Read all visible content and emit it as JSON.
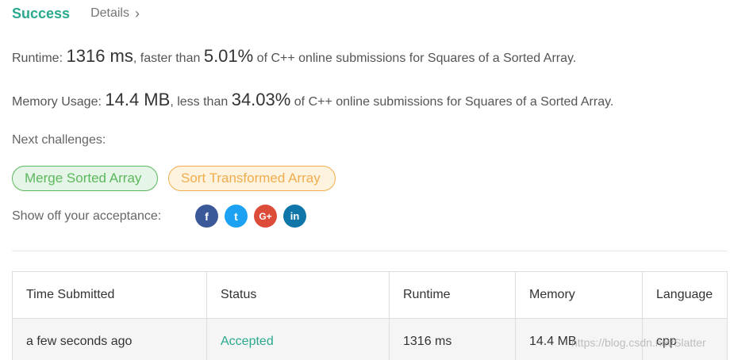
{
  "header": {
    "status": "Success",
    "details_label": "Details",
    "chevron": "›"
  },
  "runtime": {
    "label": "Runtime:",
    "value": "1316 ms",
    "mid_text": ", faster than",
    "percent": "5.01%",
    "tail_text": "of C++ online submissions for Squares of a Sorted Array."
  },
  "memory": {
    "label": "Memory Usage:",
    "value": "14.4 MB",
    "mid_text": ", less than",
    "percent": "34.03%",
    "tail_text": "of C++ online submissions for Squares of a Sorted Array."
  },
  "next": {
    "label": "Next challenges:",
    "challenges": [
      "Merge Sorted Array",
      "Sort Transformed Array"
    ]
  },
  "share": {
    "label": "Show off your acceptance:",
    "icons": [
      {
        "name": "facebook-icon",
        "glyph": "f"
      },
      {
        "name": "twitter-icon",
        "glyph": "t"
      },
      {
        "name": "google-plus-icon",
        "glyph": "G+"
      },
      {
        "name": "linkedin-icon",
        "glyph": "in"
      }
    ]
  },
  "table": {
    "headers": [
      "Time Submitted",
      "Status",
      "Runtime",
      "Memory",
      "Language"
    ],
    "rows": [
      [
        "a few seconds ago",
        "Accepted",
        "1316 ms",
        "14.4 MB",
        "cpp"
      ]
    ]
  },
  "watermark": "https://blog.csdn.net/Slatter",
  "colors": {
    "success": "#2aa98e",
    "green_chip": "#5cb85c",
    "orange_chip": "#f0ad4e",
    "facebook": "#3b5998",
    "twitter": "#1da1f2",
    "google_plus": "#dd4b39",
    "linkedin": "#0e76a8"
  }
}
